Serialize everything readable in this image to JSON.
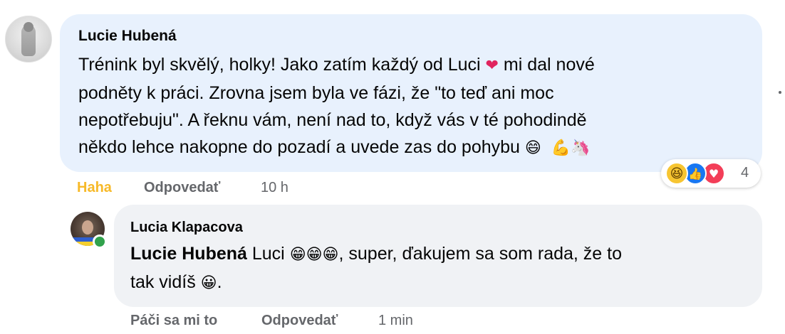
{
  "comment": {
    "author": "Lucie Hubená",
    "text_lines": [
      "Trénink byl skvělý, holky! Jako zatím každý od Luci",
      "mi dal nové",
      "podněty k práci. Zrovna jsem byla ve fázi, že \"to teď ani moc",
      "nepotřebuju\". A řeknu vám, není nad to, když vás v té pohodindě",
      "někdo lehce nakopne do pozadí a uvede zas do pohybu"
    ],
    "emojis": {
      "heart": "❤",
      "grin": "😄",
      "muscle": "💪",
      "unicorn": "🦄"
    },
    "reactions": {
      "icons": [
        "haha-icon",
        "like-icon",
        "love-icon"
      ],
      "haha_glyph": "😆",
      "like_glyph": "👍",
      "love_glyph": "♥",
      "count": "4"
    },
    "actions": {
      "reaction_label": "Haha",
      "reply_label": "Odpovedať",
      "time": "10 h"
    }
  },
  "reply": {
    "author": "Lucia Klapacova",
    "mention": "Lucie Hubená",
    "text_part1": " Luci ",
    "emojis_grin": "😁😁😁",
    "text_part2": ", super, ďakujem sa som rada, že to",
    "text_line2": "tak vidíš ",
    "emoji_smile": "😀",
    "text_end": ".",
    "actions": {
      "like_label": "Páči sa mi to",
      "reply_label": "Odpovedať",
      "time": "1 min"
    }
  },
  "colors": {
    "comment_bubble": "#e8f1fd",
    "reply_bubble": "#f0f2f5",
    "haha_label": "#f7b928",
    "secondary_text": "#65676b",
    "online": "#31a24c"
  }
}
